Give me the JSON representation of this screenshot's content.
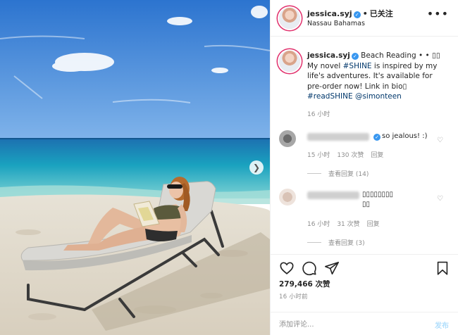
{
  "post": {
    "username": "jessica.syj",
    "follow_status": "已关注",
    "location": "Nassau Bahamas",
    "more_icon": "more-horizontal-icon"
  },
  "caption": {
    "username": "jessica.syj",
    "location_tag": "Beach Reading",
    "sep": "• • ▯▯",
    "text_before": "My novel ",
    "hashtag1": "#SHINE",
    "text_middle": " is inspired by my life's adventures. It's available for pre-order now! Link in bio▯",
    "hashtag2": "#readSHINE",
    "mention": "@simonteen",
    "time": "16 小时"
  },
  "comments": [
    {
      "text": "so jealous! :)",
      "time": "15 小时",
      "likes": "130 次赞",
      "reply_label": "回复",
      "view_replies": "查看回复 (14)"
    },
    {
      "text": "▯▯▯▯▯▯▯▯\n▯▯",
      "time": "16 小时",
      "likes": "31 次赞",
      "reply_label": "回复",
      "view_replies": "查看回复 (3)"
    }
  ],
  "actions": {
    "likes_count": "279,466",
    "likes_label": "次赞",
    "posted_time": "16 小时前",
    "icons": [
      "heart-icon",
      "comment-icon",
      "share-icon",
      "bookmark-icon"
    ]
  },
  "comment_box": {
    "placeholder": "添加评论...",
    "post_label": "发布"
  },
  "colors": {
    "sky": "#3a84d6",
    "sea": "#1d9ab5",
    "sand": "#e9e3d7",
    "link": "#00376b",
    "verified": "#3897f0"
  }
}
